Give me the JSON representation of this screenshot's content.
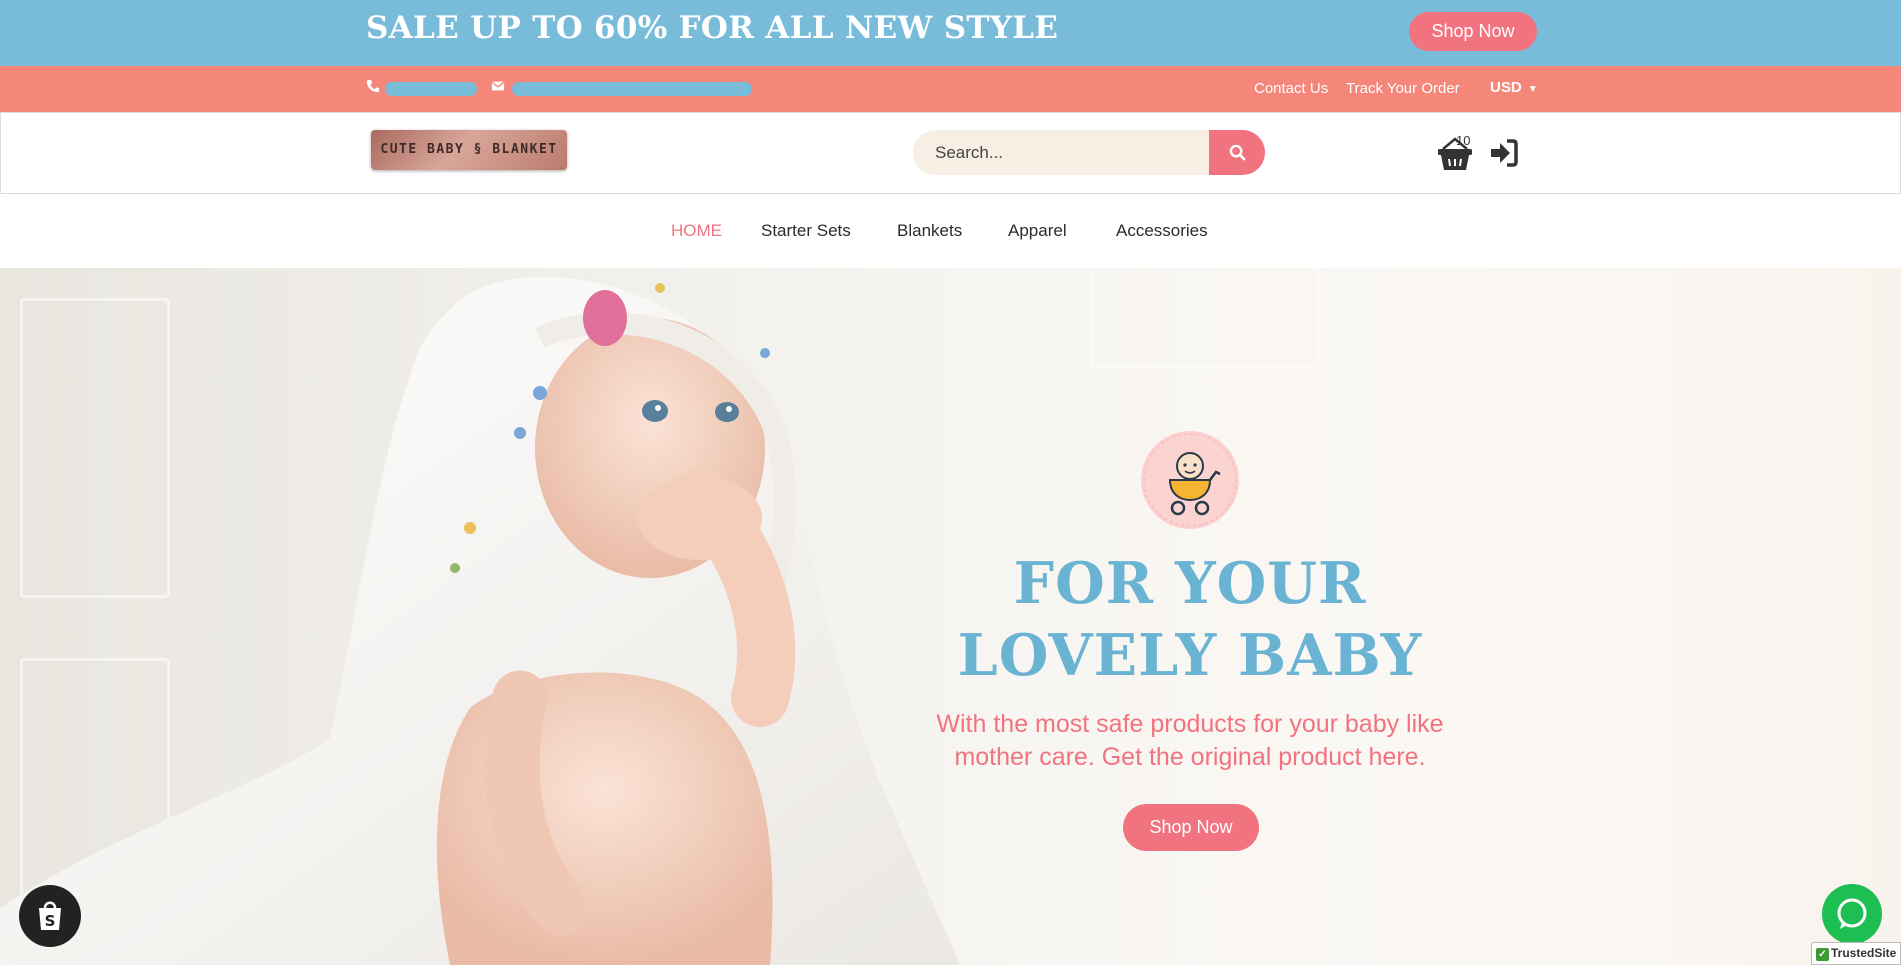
{
  "promo": {
    "text": "SALE UP TO 60% FOR ALL NEW STYLE",
    "button_label": "Shop Now"
  },
  "contact": {
    "phone_icon": "phone-icon",
    "email_icon": "envelope-icon",
    "links": [
      "Contact Us",
      "Track Your Order"
    ],
    "currency": "USD"
  },
  "header": {
    "logo_text": "CUTE BABY § BLANKET",
    "search_placeholder": "Search...",
    "search_icon": "search-icon",
    "cart_icon": "basket-icon",
    "cart_count": "10",
    "login_icon": "sign-in-icon"
  },
  "nav": {
    "items": [
      "HOME",
      "Starter Sets",
      "Blankets",
      "Apparel",
      "Accessories"
    ],
    "active": "HOME"
  },
  "hero": {
    "badge_icon": "baby-stroller-icon",
    "title_line1": "FOR YOUR",
    "title_line2": "LOVELY BABY",
    "subtitle_line1": "With the most safe products for your baby like",
    "subtitle_line2": "mother care. Get the original product here.",
    "button_label": "Shop Now"
  },
  "widgets": {
    "shopify_icon": "shopify-bag-icon",
    "chat_icon": "chat-bubble-icon",
    "trusted_label": "TrustedSite"
  },
  "colors": {
    "promo_bg": "#79bcd9",
    "contact_bg": "#f4867a",
    "accent_pink": "#f1737f",
    "title_blue": "#6ab3d2",
    "search_bg": "#f7efe4"
  }
}
